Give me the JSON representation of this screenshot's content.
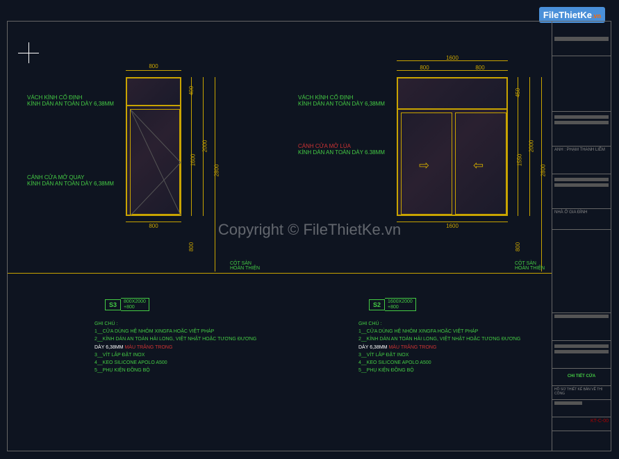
{
  "logo": {
    "main": "FileThietKe",
    "suffix": ".vn"
  },
  "watermark": "Copyright © FileThietKe.vn",
  "door1": {
    "dims": {
      "top": "800",
      "bottom": "800",
      "h_transom": "400",
      "h_panel": "1600",
      "h_total": "2000",
      "h_full": "2800",
      "h_floor": "800"
    },
    "labels": {
      "l1a": "VÁCH KÍNH CỐ ĐỊNH",
      "l1b": "KÍNH DÁN AN TOÀN DÀY 6,38MM",
      "l2a": "CÁNH CỬA MỞ QUAY",
      "l2b": "KÍNH DÁN AN TOÀN DÀY 6,38MM"
    },
    "floor": {
      "a": "CỘT SÀN",
      "b": "HOÀN THIỆN"
    },
    "tag": {
      "sym": "S3",
      "size": "800X2000",
      "ext": "+800"
    },
    "notes": {
      "title": "GHI CHÚ :",
      "n1": "1__CỬA DÙNG HỆ NHÔM XINGFA HOẶC VIỆT PHÁP",
      "n2": "2__KÍNH DÁN AN TOÀN HẢI LONG, VIỆT NHẬT HOẶC TƯƠNG ĐƯƠNG",
      "n2b": "DÀY 6,38MM",
      "n2c": "MÀU TRẮNG TRONG",
      "n3": "3__VÍT LẮP ĐẶT INOX",
      "n4": "4__KEO SILICONE APOLO A500",
      "n5": "5__PHỤ KIỆN ĐỒNG BỘ"
    }
  },
  "door2": {
    "dims": {
      "top": "1600",
      "half": "800",
      "half2": "800",
      "bottom": "1600",
      "h_transom": "450",
      "h_panel": "1550",
      "h_total": "2000",
      "h_full": "2800",
      "h_floor": "800"
    },
    "labels": {
      "l1a": "VÁCH KÍNH CỐ ĐỊNH",
      "l1b": "KÍNH DÁN AN TOÀN DÀY 6,38MM",
      "l2a": "CÁNH CỬA MỞ LÙA",
      "l2b": "KÍNH DÁN AN TOÀN DÀY 6.38MM"
    },
    "floor": {
      "a": "CỘT SÀN",
      "b": "HOÀN THIỆN"
    },
    "tag": {
      "sym": "S2",
      "size": "1600X2000",
      "ext": "+800"
    },
    "notes": {
      "title": "GHI CHÚ :",
      "n1": "1__CỬA DÙNG HỆ NHÔM XINGFA HOẶC VIỆT PHÁP",
      "n2": "2__KÍNH DÁN AN TOÀN HẢI LONG, VIỆT NHẬT HOẶC TƯƠNG ĐƯƠNG",
      "n2b": "DÀY 6,38MM",
      "n2c": "MÀU TRẮNG TRONG",
      "n3": "3__VÍT LẮP ĐẶT INOX",
      "n4": "4__KEO SILICONE APOLO A500",
      "n5": "5__PHỤ KIỆN ĐỒNG BỘ"
    }
  },
  "titleblock": {
    "owner": "ANH : PHẠM THANH LIÊM",
    "project": "NHÀ Ở GIA ĐÌNH",
    "drawing_title": "CHI TIẾT CỬA",
    "hosso": "HỒ SƠ THIẾT KẾ BẢN VẼ THI CÔNG",
    "code": "KT-C-00"
  }
}
